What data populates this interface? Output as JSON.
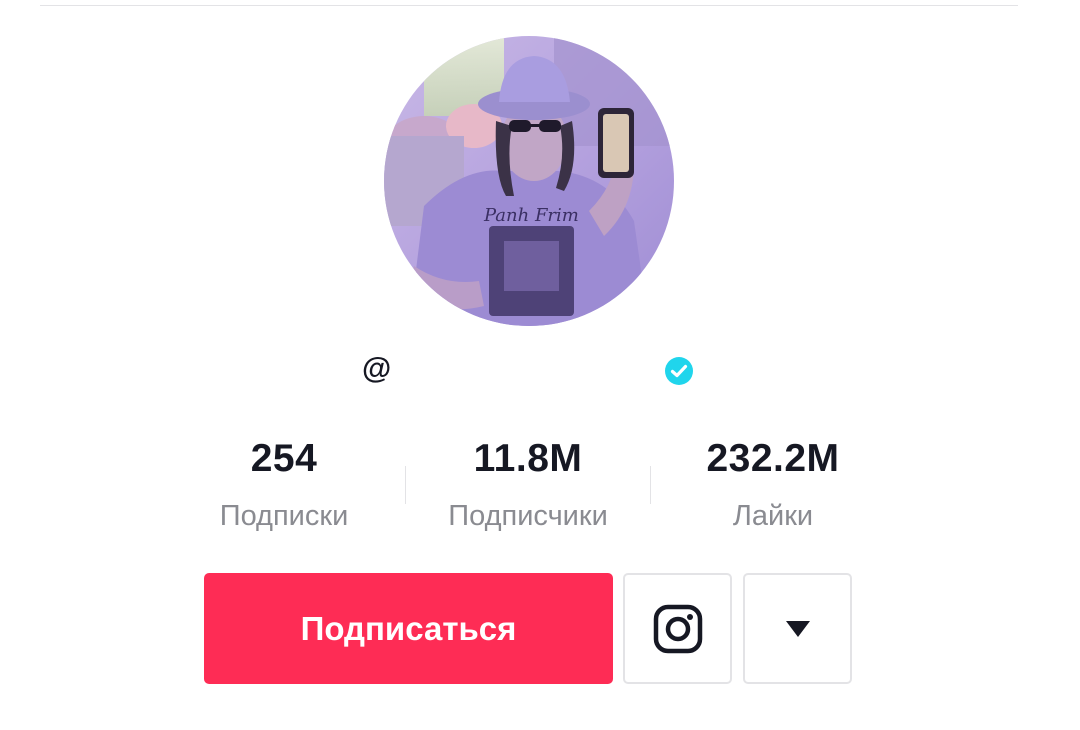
{
  "profile": {
    "handle_prefix": "@",
    "verified": true,
    "avatar_description_icon": "profile-photo"
  },
  "stats": [
    {
      "value": "254",
      "label": "Подписки"
    },
    {
      "value": "11.8M",
      "label": "Подписчики"
    },
    {
      "value": "232.2M",
      "label": "Лайки"
    }
  ],
  "actions": {
    "follow_label": "Подписаться",
    "instagram_icon": "instagram-icon",
    "more_icon": "caret-down-icon"
  },
  "colors": {
    "accent": "#fe2c55",
    "verified": "#20d5ec",
    "text_primary": "#161823",
    "text_secondary": "#8a8b91",
    "border": "#e3e3e6"
  }
}
